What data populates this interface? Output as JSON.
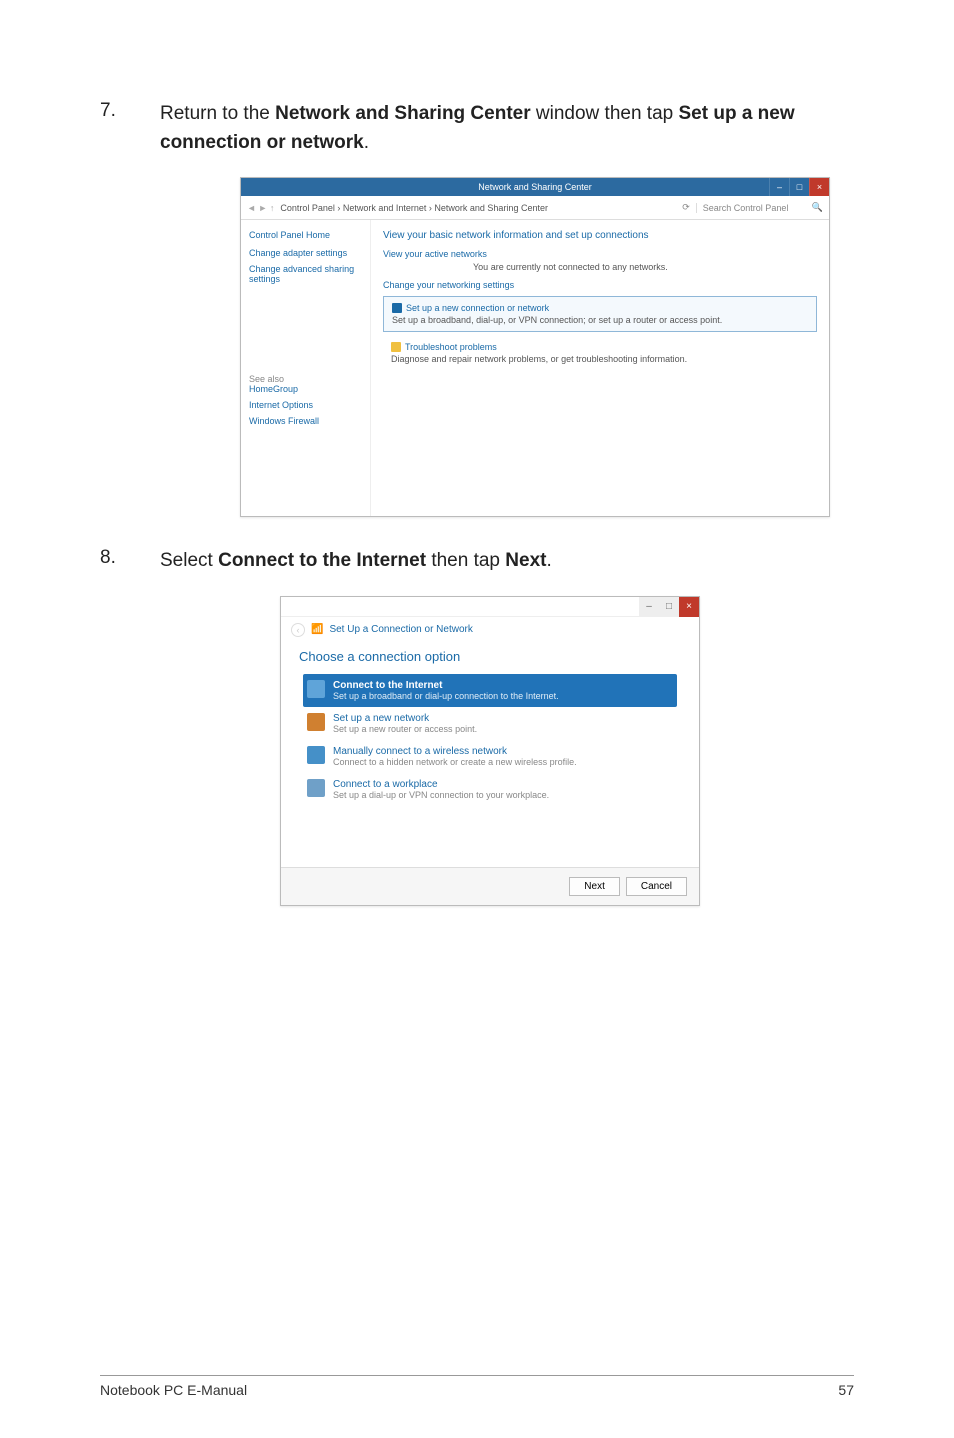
{
  "step7": {
    "num": "7.",
    "text_pre": "Return to the ",
    "bold1": "Network and Sharing Center",
    "text_mid": " window then tap ",
    "bold2": "Set up a new connection or network",
    "text_post": "."
  },
  "shot1": {
    "title": "Network and Sharing Center",
    "path": "Control Panel  ›  Network and Internet  ›  Network and Sharing Center",
    "refresh": "⟳",
    "search_placeholder": "Search Control Panel",
    "sidebar": {
      "home": "Control Panel Home",
      "links": [
        "Change adapter settings",
        "Change advanced sharing settings"
      ],
      "seealso_head": "See also",
      "seealso": [
        "HomeGroup",
        "Internet Options",
        "Windows Firewall"
      ]
    },
    "main": {
      "heading": "View your basic network information and set up connections",
      "active_label": "View your active networks",
      "active_status": "You are currently not connected to any networks.",
      "change_label": "Change your networking settings",
      "box_setup_title": "Set up a new connection or network",
      "box_setup_desc": "Set up a broadband, dial-up, or VPN connection; or set up a router or access point.",
      "box_trouble_title": "Troubleshoot problems",
      "box_trouble_desc": "Diagnose and repair network problems, or get troubleshooting information."
    }
  },
  "step8": {
    "num": "8.",
    "text_pre": "Select ",
    "bold1": "Connect to the Internet",
    "text_mid": " then tap ",
    "bold2": "Next",
    "text_post": "."
  },
  "shot2": {
    "crumb": "Set Up a Connection or Network",
    "heading": "Choose a connection option",
    "options": [
      {
        "title": "Connect to the Internet",
        "desc": "Set up a broadband or dial-up connection to the Internet."
      },
      {
        "title": "Set up a new network",
        "desc": "Set up a new router or access point."
      },
      {
        "title": "Manually connect to a wireless network",
        "desc": "Connect to a hidden network or create a new wireless profile."
      },
      {
        "title": "Connect to a workplace",
        "desc": "Set up a dial-up or VPN connection to your workplace."
      }
    ],
    "next": "Next",
    "cancel": "Cancel"
  },
  "footer": {
    "left": "Notebook PC E-Manual",
    "right": "57"
  }
}
